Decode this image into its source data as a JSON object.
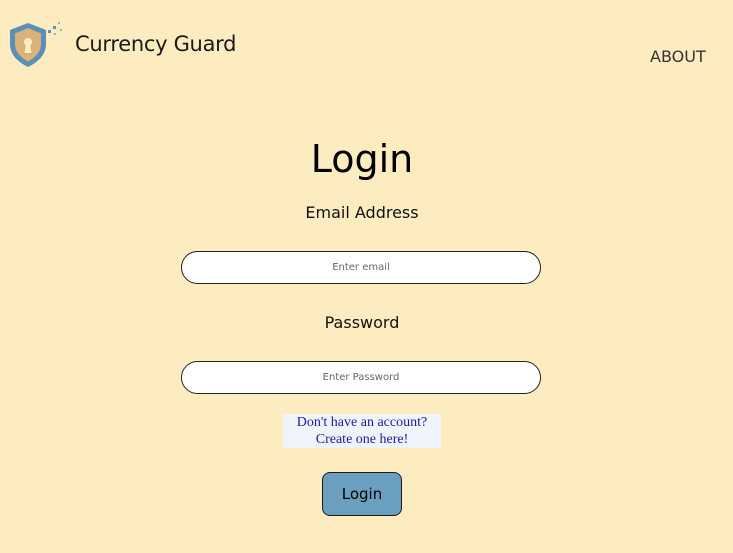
{
  "header": {
    "brand_name": "Currency Guard",
    "logo_icon": "shield-keyhole-icon",
    "nav": {
      "about_label": "ABOUT"
    }
  },
  "login_form": {
    "title": "Login",
    "email": {
      "label": "Email Address",
      "placeholder": "Enter email",
      "value": ""
    },
    "password": {
      "label": "Password",
      "placeholder": "Enter Password",
      "value": ""
    },
    "signup_link": {
      "line1": "Don't have an account?",
      "line2": "Create one here!"
    },
    "submit_label": "Login"
  },
  "colors": {
    "background": "#fcecc0",
    "button": "#6a9fbf",
    "link": "#1a1aa6",
    "link_background": "#eef4f9",
    "shield_blue": "#5b8fb5",
    "shield_gold": "#d8b27a"
  }
}
